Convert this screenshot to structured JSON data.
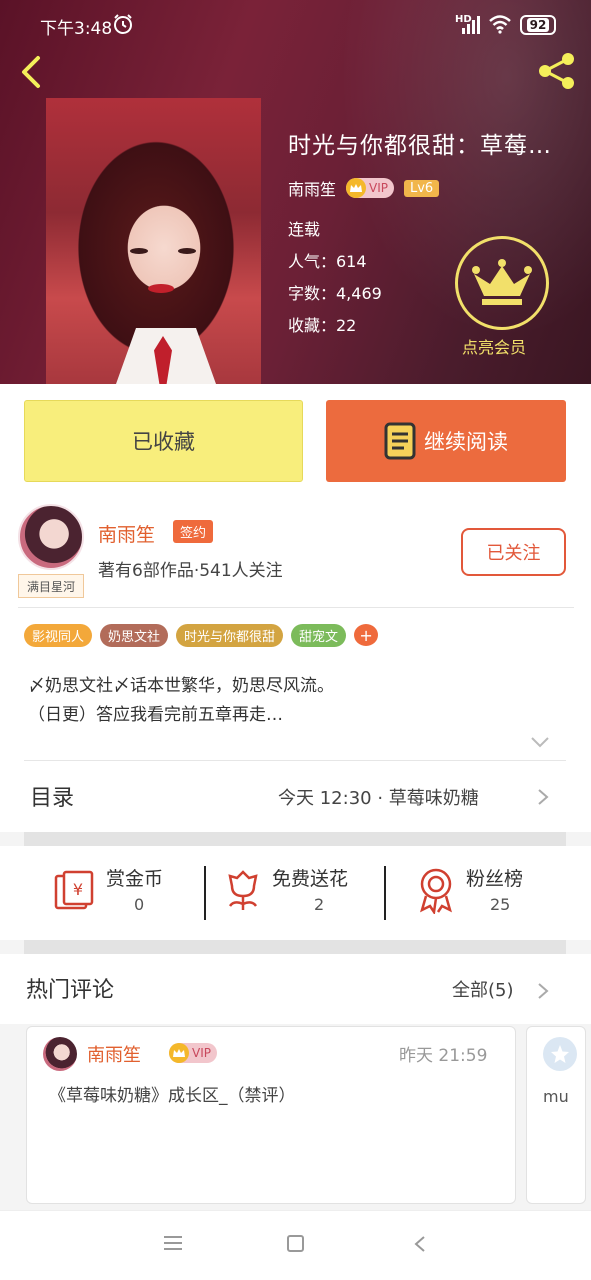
{
  "status": {
    "time": "下午3:48",
    "hd": "HD",
    "battery": "92"
  },
  "book": {
    "title": "时光与你都很甜：草莓…",
    "author": "南雨笙",
    "vip": "VIP",
    "level": "Lv6",
    "state": "连载",
    "popularity": "人气：614",
    "words": "字数：4,469",
    "favorites": "收藏：22",
    "member_label": "点亮会员"
  },
  "actions": {
    "collected": "已收藏",
    "continue": "继续阅读"
  },
  "author": {
    "name": "南雨笙",
    "sign": "签约",
    "stats": "著有6部作品·541人关注",
    "follow": "已关注",
    "avatar_tag": "满目星河"
  },
  "tags": [
    {
      "label": "影视同人",
      "color": "#f3a83a"
    },
    {
      "label": "奶思文社",
      "color": "#b26c5a"
    },
    {
      "label": "时光与你都很甜",
      "color": "#d3a441"
    },
    {
      "label": "甜宠文",
      "color": "#7cbb5b"
    }
  ],
  "tag_more": "+",
  "synopsis": {
    "line1": "〆奶思文社〆话本世繁华，奶思尽风流。",
    "line2": "（日更）答应我看完前五章再走…"
  },
  "catalog": {
    "label": "目录",
    "latest": "今天 12:30 · 草莓味奶糖"
  },
  "stats": [
    {
      "label": "赏金币",
      "value": "0"
    },
    {
      "label": "免费送花",
      "value": "2"
    },
    {
      "label": "粉丝榜",
      "value": "25"
    }
  ],
  "comments": {
    "title": "热门评论",
    "all": "全部(5)",
    "items": [
      {
        "name": "南雨笙",
        "vip": "VIP",
        "time": "昨天 21:59",
        "text": "《草莓味奶糖》成长区_（禁评）"
      },
      {
        "text": "mu"
      }
    ]
  },
  "colors": {
    "accent": "#ec6b3e",
    "collected_bg": "#f8ee7c",
    "member_gold": "#f2e06a"
  }
}
